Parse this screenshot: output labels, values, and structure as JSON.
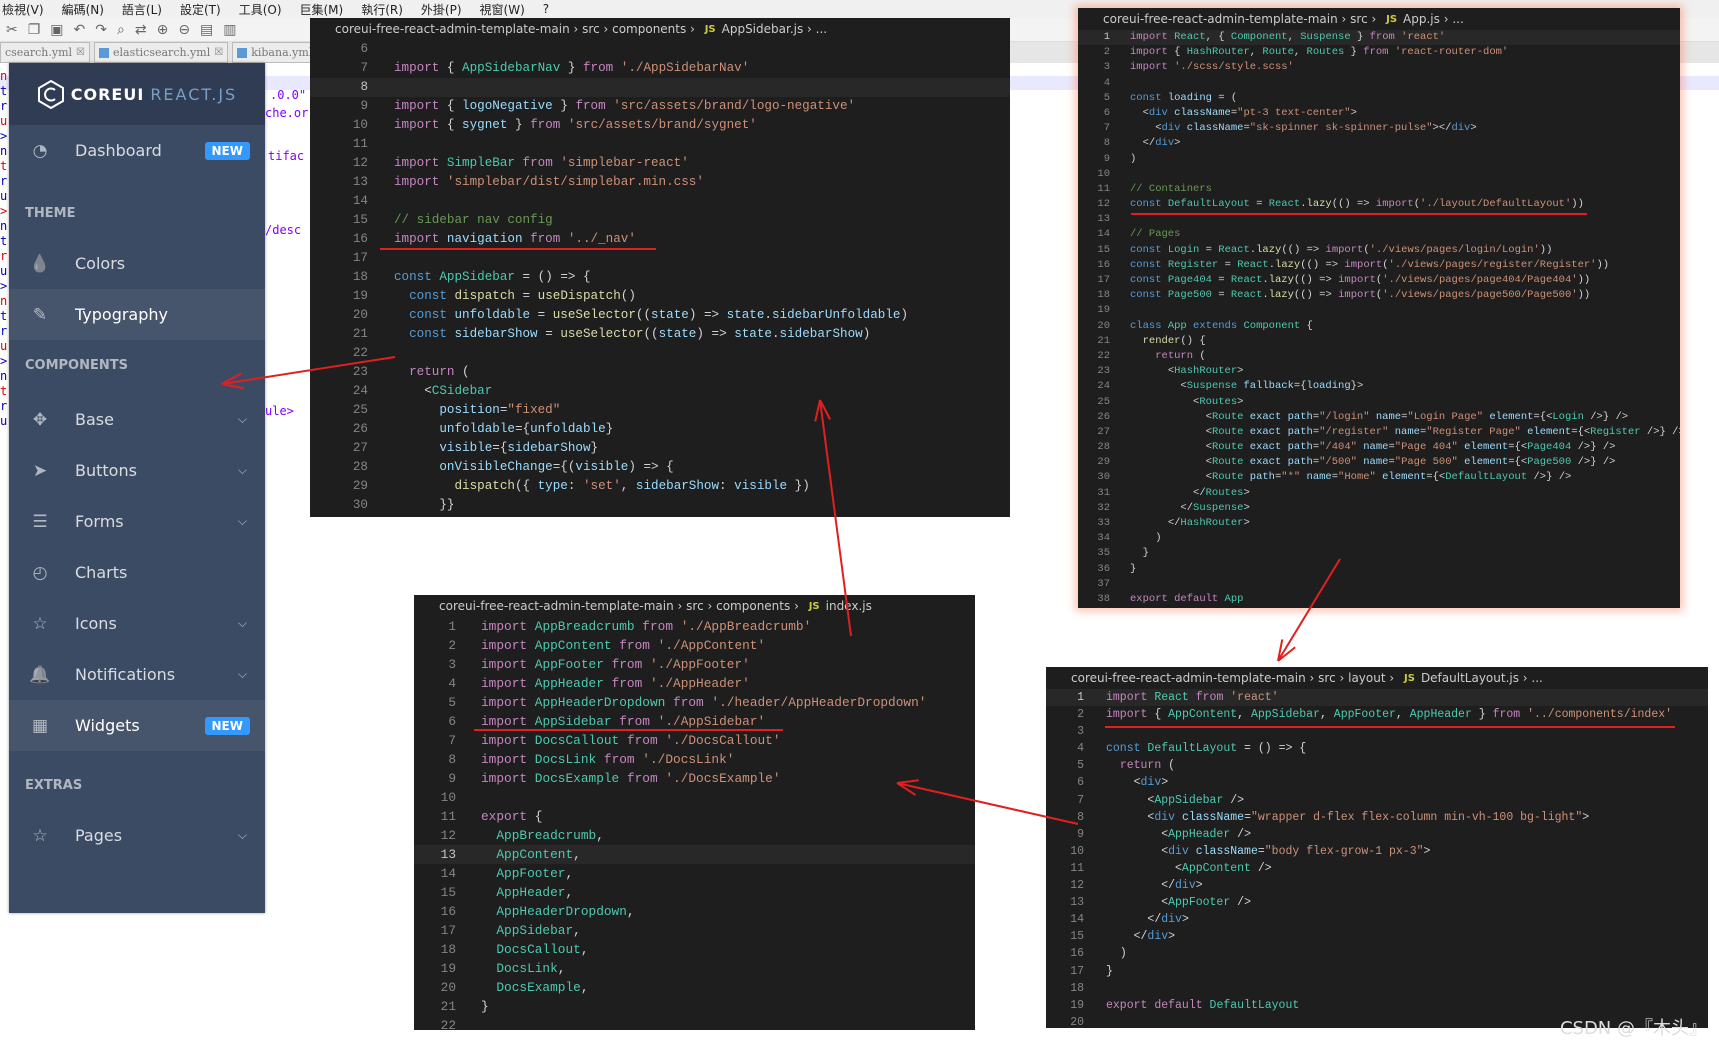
{
  "menu": [
    "檢視(V)",
    "編碼(N)",
    "語言(L)",
    "設定(T)",
    "工具(O)",
    "巨集(M)",
    "執行(R)",
    "外掛(P)",
    "視窗(W)",
    "?"
  ],
  "notepad_tabs": [
    "csearch.yml",
    "elasticsearch.yml",
    "kibana.yml",
    "n"
  ],
  "bg_fragments": [
    ".0.0\"",
    "che.or",
    "tifac",
    "/desc",
    "ule>"
  ],
  "sidebar": {
    "logo_bold": "COREUI",
    "logo_light": "REACT.JS",
    "items": [
      {
        "label": "Dashboard",
        "icon": "speedometer-icon",
        "badge": "NEW"
      },
      {
        "title": "THEME"
      },
      {
        "label": "Colors",
        "icon": "drop-icon"
      },
      {
        "label": "Typography",
        "icon": "pencil-icon",
        "active": true
      },
      {
        "title": "COMPONENTS"
      },
      {
        "label": "Base",
        "icon": "puzzle-icon",
        "chevron": true
      },
      {
        "label": "Buttons",
        "icon": "cursor-icon",
        "chevron": true
      },
      {
        "label": "Forms",
        "icon": "notes-icon",
        "chevron": true
      },
      {
        "label": "Charts",
        "icon": "chart-pie-icon"
      },
      {
        "label": "Icons",
        "icon": "star-icon",
        "chevron": true
      },
      {
        "label": "Notifications",
        "icon": "bell-icon",
        "chevron": true
      },
      {
        "label": "Widgets",
        "icon": "calculator-icon",
        "badge": "NEW",
        "active": true
      },
      {
        "title": "EXTRAS"
      },
      {
        "label": "Pages",
        "icon": "star-icon",
        "chevron": true
      }
    ]
  },
  "editors": [
    {
      "id": "appsidebar",
      "breadcrumb": [
        "coreui-free-react-admin-template-main",
        "src",
        "components",
        "AppSidebar.js",
        "..."
      ],
      "start": 6,
      "current": 8,
      "lines": [
        "",
        "import { AppSidebarNav } from './AppSidebarNav'",
        "",
        "import { logoNegative } from 'src/assets/brand/logo-negative'",
        "import { sygnet } from 'src/assets/brand/sygnet'",
        "",
        "import SimpleBar from 'simplebar-react'",
        "import 'simplebar/dist/simplebar.min.css'",
        "",
        "// sidebar nav config",
        "import navigation from '../_nav'",
        "",
        "const AppSidebar = () => {",
        "  const dispatch = useDispatch()",
        "  const unfoldable = useSelector((state) => state.sidebarUnfoldable)",
        "  const sidebarShow = useSelector((state) => state.sidebarShow)",
        "",
        "  return (",
        "    <CSidebar",
        "      position=\"fixed\"",
        "      unfoldable={unfoldable}",
        "      visible={sidebarShow}",
        "      onVisibleChange={(visible) => {",
        "        dispatch({ type: 'set', sidebarShow: visible })",
        "      }}"
      ]
    },
    {
      "id": "index",
      "breadcrumb": [
        "coreui-free-react-admin-template-main",
        "src",
        "components",
        "index.js"
      ],
      "start": 1,
      "current": 13,
      "lines": [
        "import AppBreadcrumb from './AppBreadcrumb'",
        "import AppContent from './AppContent'",
        "import AppFooter from './AppFooter'",
        "import AppHeader from './AppHeader'",
        "import AppHeaderDropdown from './header/AppHeaderDropdown'",
        "import AppSidebar from './AppSidebar'",
        "import DocsCallout from './DocsCallout'",
        "import DocsLink from './DocsLink'",
        "import DocsExample from './DocsExample'",
        "",
        "export {",
        "  AppBreadcrumb,",
        "  AppContent,",
        "  AppFooter,",
        "  AppHeader,",
        "  AppHeaderDropdown,",
        "  AppSidebar,",
        "  DocsCallout,",
        "  DocsLink,",
        "  DocsExample,",
        "}",
        ""
      ]
    },
    {
      "id": "app",
      "breadcrumb": [
        "coreui-free-react-admin-template-main",
        "src",
        "App.js",
        "..."
      ],
      "start": 1,
      "current": 1,
      "lines": [
        "import React, { Component, Suspense } from 'react'",
        "import { HashRouter, Route, Routes } from 'react-router-dom'",
        "import './scss/style.scss'",
        "",
        "const loading = (",
        "  <div className=\"pt-3 text-center\">",
        "    <div className=\"sk-spinner sk-spinner-pulse\"></div>",
        "  </div>",
        ")",
        "",
        "// Containers",
        "const DefaultLayout = React.lazy(() => import('./layout/DefaultLayout'))",
        "",
        "// Pages",
        "const Login = React.lazy(() => import('./views/pages/login/Login'))",
        "const Register = React.lazy(() => import('./views/pages/register/Register'))",
        "const Page404 = React.lazy(() => import('./views/pages/page404/Page404'))",
        "const Page500 = React.lazy(() => import('./views/pages/page500/Page500'))",
        "",
        "class App extends Component {",
        "  render() {",
        "    return (",
        "      <HashRouter>",
        "        <Suspense fallback={loading}>",
        "          <Routes>",
        "            <Route exact path=\"/login\" name=\"Login Page\" element={<Login />} />",
        "            <Route exact path=\"/register\" name=\"Register Page\" element={<Register />} />",
        "            <Route exact path=\"/404\" name=\"Page 404\" element={<Page404 />} />",
        "            <Route exact path=\"/500\" name=\"Page 500\" element={<Page500 />} />",
        "            <Route path=\"*\" name=\"Home\" element={<DefaultLayout />} />",
        "          </Routes>",
        "        </Suspense>",
        "      </HashRouter>",
        "    )",
        "  }",
        "}",
        "",
        "export default App",
        ""
      ]
    },
    {
      "id": "defaultlayout",
      "breadcrumb": [
        "coreui-free-react-admin-template-main",
        "src",
        "layout",
        "DefaultLayout.js",
        "..."
      ],
      "start": 1,
      "current": 1,
      "lines": [
        "import React from 'react'",
        "import { AppContent, AppSidebar, AppFooter, AppHeader } from '../components/index'",
        "",
        "const DefaultLayout = () => {",
        "  return (",
        "    <div>",
        "      <AppSidebar />",
        "      <div className=\"wrapper d-flex flex-column min-vh-100 bg-light\">",
        "        <AppHeader />",
        "        <div className=\"body flex-grow-1 px-3\">",
        "          <AppContent />",
        "        </div>",
        "        <AppFooter />",
        "      </div>",
        "    </div>",
        "  )",
        "}",
        "",
        "export default DefaultLayout",
        ""
      ]
    }
  ],
  "annotation_color": "#e02020",
  "watermark": "CSDN @『木头』"
}
